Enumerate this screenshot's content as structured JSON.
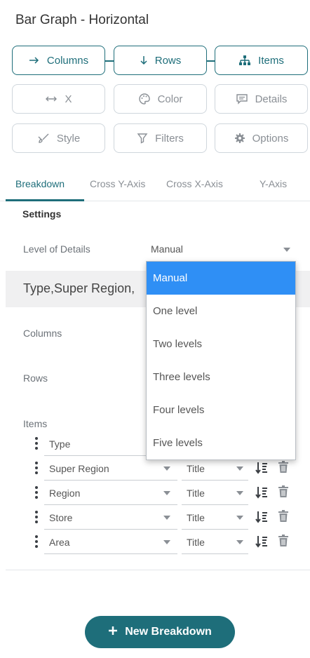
{
  "header": {
    "title": "Bar Graph - Horizontal"
  },
  "toolbar": {
    "columns": "Columns",
    "rows": "Rows",
    "items": "Items",
    "x": "X",
    "color": "Color",
    "details": "Details",
    "style": "Style",
    "filters": "Filters",
    "options": "Options"
  },
  "tabs": [
    "Breakdown",
    "Cross Y-Axis",
    "Cross X-Axis",
    "Y-Axis"
  ],
  "settings": {
    "heading": "Settings",
    "level_label": "Level of Details",
    "level_value": "Manual"
  },
  "breakdown": {
    "header": "Type,Super Region,",
    "columns_label": "Columns",
    "rows_label": "Rows",
    "items_label": "Items",
    "items": [
      {
        "name": "Type",
        "format": ""
      },
      {
        "name": "Super Region",
        "format": "Title"
      },
      {
        "name": "Region",
        "format": "Title"
      },
      {
        "name": "Store",
        "format": "Title"
      },
      {
        "name": "Area",
        "format": "Title"
      }
    ]
  },
  "dropdown": {
    "options": [
      "Manual",
      "One level",
      "Two levels",
      "Three levels",
      "Four levels",
      "Five levels"
    ],
    "selected": "Manual"
  },
  "footer": {
    "new_breakdown": "New Breakdown"
  },
  "colors": {
    "accent": "#1e6e7a",
    "selected": "#2f8ff5"
  }
}
